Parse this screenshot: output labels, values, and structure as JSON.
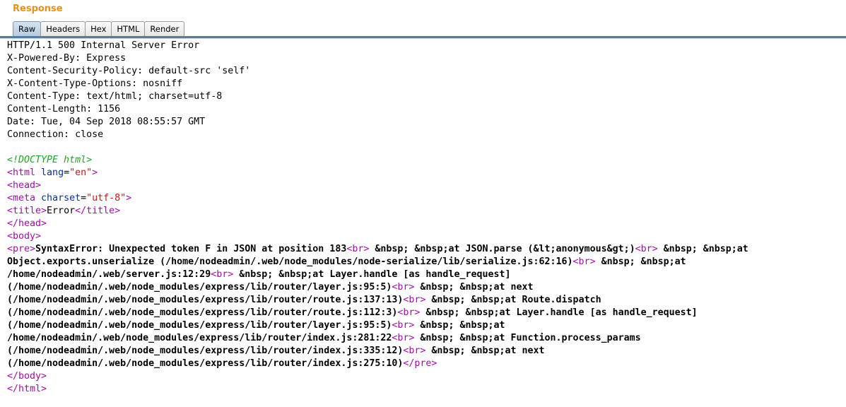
{
  "panel": {
    "title": "Response"
  },
  "tabs": [
    {
      "label": "Raw",
      "active": true
    },
    {
      "label": "Headers",
      "active": false
    },
    {
      "label": "Hex",
      "active": false
    },
    {
      "label": "HTML",
      "active": false
    },
    {
      "label": "Render",
      "active": false
    }
  ],
  "headers": [
    "HTTP/1.1 500 Internal Server Error",
    "X-Powered-By: Express",
    "Content-Security-Policy: default-src 'self'",
    "X-Content-Type-Options: nosniff",
    "Content-Type: text/html; charset=utf-8",
    "Content-Length: 1156",
    "Date: Tue, 04 Sep 2018 08:55:57 GMT",
    "Connection: close"
  ],
  "html_body": {
    "doctype": "<!DOCTYPE html>",
    "html_open": "<html",
    "lang_attr": "lang",
    "lang_eq": "=",
    "lang_val": "\"en\"",
    "gt": ">",
    "head_open": "<head>",
    "meta_open": "<meta",
    "charset_attr": "charset",
    "charset_val": "\"utf-8\"",
    "title_open": "<title>",
    "title_text": "Error",
    "title_close": "</title>",
    "head_close": "</head>",
    "body_open": "<body>",
    "pre_open": "<pre>",
    "pre_close": "</pre>",
    "body_close": "</body>",
    "html_close": "</html>",
    "br": "<br>"
  },
  "pre_lines": [
    [
      "SyntaxError: Unexpected token F in JSON at position 183",
      "<br>",
      " &nbsp; &nbsp;at JSON.parse (&lt;anonymous&gt;)",
      "<br>",
      " &nbsp; &nbsp;at"
    ],
    [
      "Object.exports.unserialize (/home/nodeadmin/.web/node_modules/node-serialize/lib/serialize.js:62:16)",
      "<br>",
      " &nbsp; &nbsp;at"
    ],
    [
      "/home/nodeadmin/.web/server.js:12:29",
      "<br>",
      " &nbsp; &nbsp;at Layer.handle [as handle_request]"
    ],
    [
      "(/home/nodeadmin/.web/node_modules/express/lib/router/layer.js:95:5)",
      "<br>",
      " &nbsp; &nbsp;at next"
    ],
    [
      "(/home/nodeadmin/.web/node_modules/express/lib/router/route.js:137:13)",
      "<br>",
      " &nbsp; &nbsp;at Route.dispatch"
    ],
    [
      "(/home/nodeadmin/.web/node_modules/express/lib/router/route.js:112:3)",
      "<br>",
      " &nbsp; &nbsp;at Layer.handle [as handle_request]"
    ],
    [
      "(/home/nodeadmin/.web/node_modules/express/lib/router/layer.js:95:5)",
      "<br>",
      " &nbsp; &nbsp;at"
    ],
    [
      "/home/nodeadmin/.web/node_modules/express/lib/router/index.js:281:22",
      "<br>",
      " &nbsp; &nbsp;at Function.process_params"
    ],
    [
      "(/home/nodeadmin/.web/node_modules/express/lib/router/index.js:335:12)",
      "<br>",
      " &nbsp; &nbsp;at next"
    ],
    [
      "(/home/nodeadmin/.web/node_modules/express/lib/router/index.js:275:10)"
    ]
  ]
}
